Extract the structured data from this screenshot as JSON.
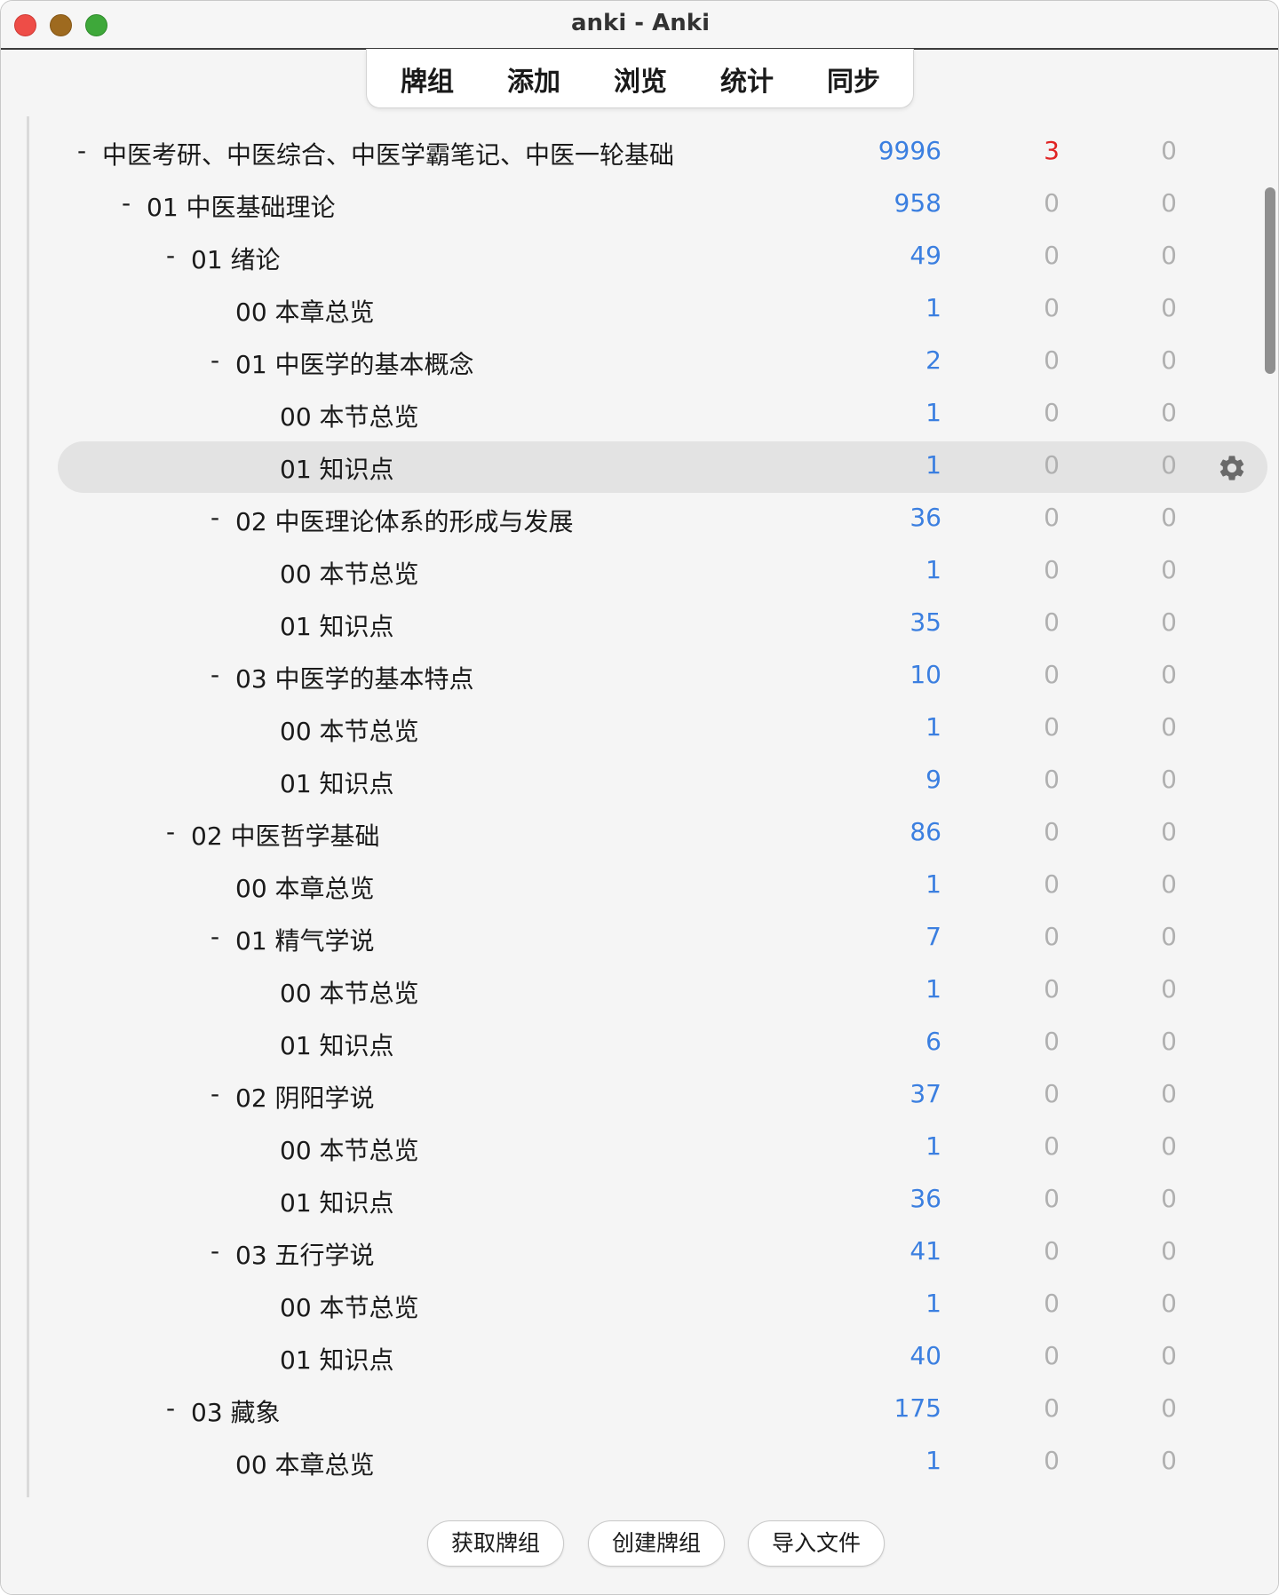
{
  "window": {
    "title": "anki - Anki"
  },
  "toolbar": {
    "items": [
      {
        "label": "牌组"
      },
      {
        "label": "添加"
      },
      {
        "label": "浏览"
      },
      {
        "label": "统计"
      },
      {
        "label": "同步"
      }
    ]
  },
  "colors": {
    "new": "#3b7fe0",
    "learn_nonzero": "#e02424",
    "zero": "#b0b0b0",
    "selected_row": "#e3e3e3"
  },
  "decks": [
    {
      "name": "中医考研、中医综合、中医学霸笔记、中医一轮基础",
      "collapse": "-",
      "new": "9996",
      "learn": "3",
      "due": "0"
    },
    {
      "name": "01 中医基础理论",
      "collapse": "-",
      "new": "958",
      "learn": "0",
      "due": "0"
    },
    {
      "name": "01 绪论",
      "collapse": "-",
      "new": "49",
      "learn": "0",
      "due": "0"
    },
    {
      "name": "00 本章总览",
      "collapse": "",
      "new": "1",
      "learn": "0",
      "due": "0"
    },
    {
      "name": "01 中医学的基本概念",
      "collapse": "-",
      "new": "2",
      "learn": "0",
      "due": "0"
    },
    {
      "name": "00 本节总览",
      "collapse": "",
      "new": "1",
      "learn": "0",
      "due": "0"
    },
    {
      "name": "01 知识点",
      "collapse": "",
      "new": "1",
      "learn": "0",
      "due": "0",
      "selected": true
    },
    {
      "name": "02 中医理论体系的形成与发展",
      "collapse": "-",
      "new": "36",
      "learn": "0",
      "due": "0"
    },
    {
      "name": "00 本节总览",
      "collapse": "",
      "new": "1",
      "learn": "0",
      "due": "0"
    },
    {
      "name": "01 知识点",
      "collapse": "",
      "new": "35",
      "learn": "0",
      "due": "0"
    },
    {
      "name": "03 中医学的基本特点",
      "collapse": "-",
      "new": "10",
      "learn": "0",
      "due": "0"
    },
    {
      "name": "00 本节总览",
      "collapse": "",
      "new": "1",
      "learn": "0",
      "due": "0"
    },
    {
      "name": "01 知识点",
      "collapse": "",
      "new": "9",
      "learn": "0",
      "due": "0"
    },
    {
      "name": "02 中医哲学基础",
      "collapse": "-",
      "new": "86",
      "learn": "0",
      "due": "0"
    },
    {
      "name": "00 本章总览",
      "collapse": "",
      "new": "1",
      "learn": "0",
      "due": "0"
    },
    {
      "name": "01 精气学说",
      "collapse": "-",
      "new": "7",
      "learn": "0",
      "due": "0"
    },
    {
      "name": "00 本节总览",
      "collapse": "",
      "new": "1",
      "learn": "0",
      "due": "0"
    },
    {
      "name": "01 知识点",
      "collapse": "",
      "new": "6",
      "learn": "0",
      "due": "0"
    },
    {
      "name": "02 阴阳学说",
      "collapse": "-",
      "new": "37",
      "learn": "0",
      "due": "0"
    },
    {
      "name": "00 本节总览",
      "collapse": "",
      "new": "1",
      "learn": "0",
      "due": "0"
    },
    {
      "name": "01 知识点",
      "collapse": "",
      "new": "36",
      "learn": "0",
      "due": "0"
    },
    {
      "name": "03 五行学说",
      "collapse": "-",
      "new": "41",
      "learn": "0",
      "due": "0"
    },
    {
      "name": "00 本节总览",
      "collapse": "",
      "new": "1",
      "learn": "0",
      "due": "0"
    },
    {
      "name": "01 知识点",
      "collapse": "",
      "new": "40",
      "learn": "0",
      "due": "0"
    },
    {
      "name": "03 藏象",
      "collapse": "-",
      "new": "175",
      "learn": "0",
      "due": "0"
    },
    {
      "name": "00 本章总览",
      "collapse": "",
      "new": "1",
      "learn": "0",
      "due": "0"
    }
  ],
  "bottom": {
    "get_shared": "获取牌组",
    "create_deck": "创建牌组",
    "import_file": "导入文件"
  }
}
